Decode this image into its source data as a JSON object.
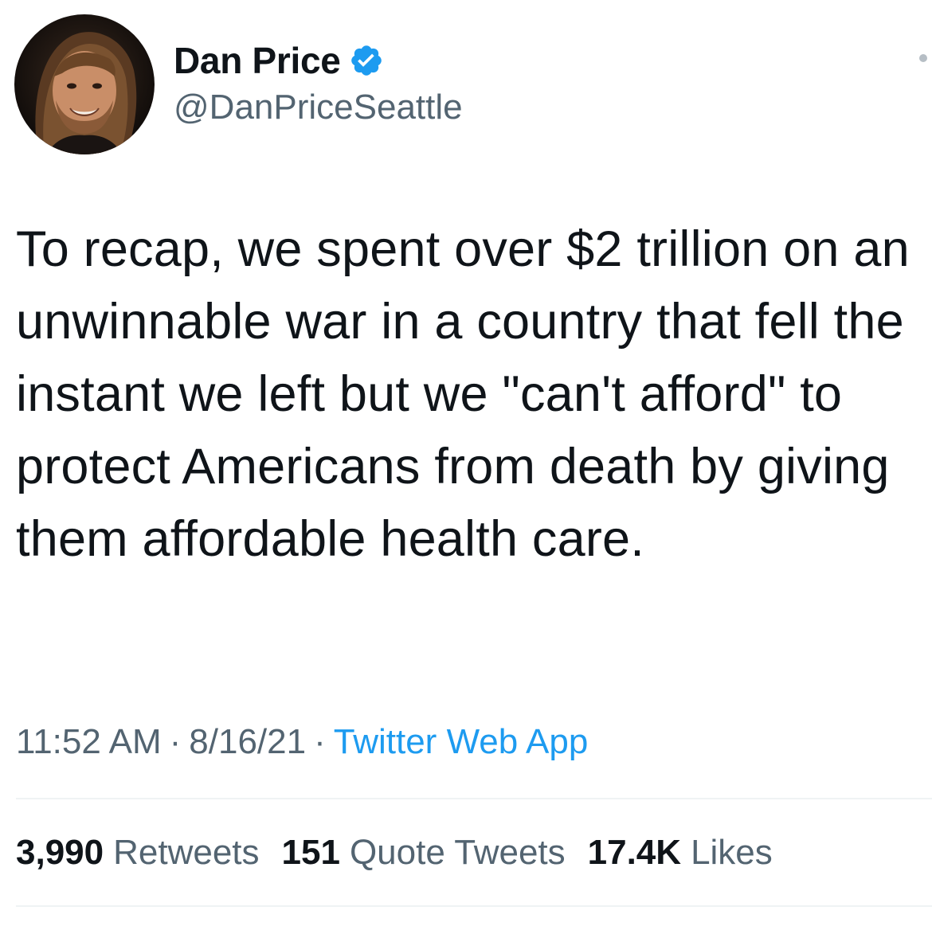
{
  "author": {
    "display_name": "Dan Price",
    "handle": "@DanPriceSeattle",
    "verified": true,
    "avatar_icon": "person-portrait-avatar",
    "verified_icon": "verified-badge-icon",
    "verified_color": "#1d9bf0"
  },
  "tweet": {
    "text": "To recap, we spent over $2 trillion on an unwinnable war in a country that fell the instant we left but we \"can't afford\" to protect Americans from death by giving them affordable health care."
  },
  "meta": {
    "time": "11:52 AM",
    "date": "8/16/21",
    "separator": "·",
    "source": "Twitter Web App",
    "source_color": "#1d9bf0"
  },
  "stats": {
    "retweets": {
      "count": "3,990",
      "label": "Retweets"
    },
    "quotes": {
      "count": "151",
      "label": "Quote Tweets"
    },
    "likes": {
      "count": "17.4K",
      "label": "Likes"
    }
  },
  "colors": {
    "text": "#0f1419",
    "secondary": "#536471",
    "accent": "#1d9bf0",
    "divider": "#eff3f4"
  }
}
